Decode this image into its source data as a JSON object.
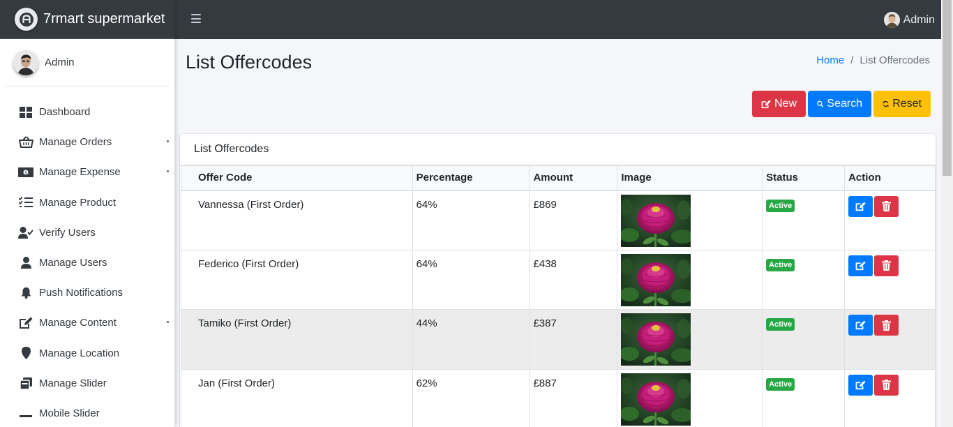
{
  "app": {
    "brand": "7rmart supermarket"
  },
  "topbar": {
    "user_name": "Admin"
  },
  "sidebar": {
    "user_name": "Admin",
    "items": [
      {
        "label": "Dashboard",
        "icon": "dashboard-icon"
      },
      {
        "label": "Manage Orders",
        "icon": "basket-icon",
        "has_children": true
      },
      {
        "label": "Manage Expense",
        "icon": "money-icon",
        "has_children": true
      },
      {
        "label": "Manage Product",
        "icon": "tasks-icon"
      },
      {
        "label": "Verify Users",
        "icon": "user-check-icon"
      },
      {
        "label": "Manage Users",
        "icon": "user-icon"
      },
      {
        "label": "Push Notifications",
        "icon": "bell-icon"
      },
      {
        "label": "Manage Content",
        "icon": "edit-icon",
        "has_children": true
      },
      {
        "label": "Manage Location",
        "icon": "map-marker-icon"
      },
      {
        "label": "Manage Slider",
        "icon": "slider-icon"
      },
      {
        "label": "Mobile Slider",
        "icon": "minus-icon"
      }
    ]
  },
  "page": {
    "title": "List Offercodes",
    "breadcrumb": {
      "home": "Home",
      "separator": "/",
      "current": "List Offercodes"
    }
  },
  "buttons": {
    "new": "New",
    "search": "Search",
    "reset": "Reset"
  },
  "card": {
    "title": "List Offercodes"
  },
  "table": {
    "columns": [
      "Offer Code",
      "Percentage",
      "Amount",
      "Image",
      "Status",
      "Action"
    ],
    "rows": [
      {
        "offer_code": "Vannessa (First Order)",
        "percentage": "64%",
        "amount": "£869",
        "status": "Active"
      },
      {
        "offer_code": "Federico (First Order)",
        "percentage": "64%",
        "amount": "£438",
        "status": "Active"
      },
      {
        "offer_code": "Tamiko (First Order)",
        "percentage": "44%",
        "amount": "£387",
        "status": "Active"
      },
      {
        "offer_code": "Jan (First Order)",
        "percentage": "62%",
        "amount": "£887",
        "status": "Active"
      }
    ]
  },
  "colors": {
    "navbar": "#343a40",
    "danger": "#dc3545",
    "primary": "#007bff",
    "warning": "#ffc107",
    "success": "#28a745"
  }
}
